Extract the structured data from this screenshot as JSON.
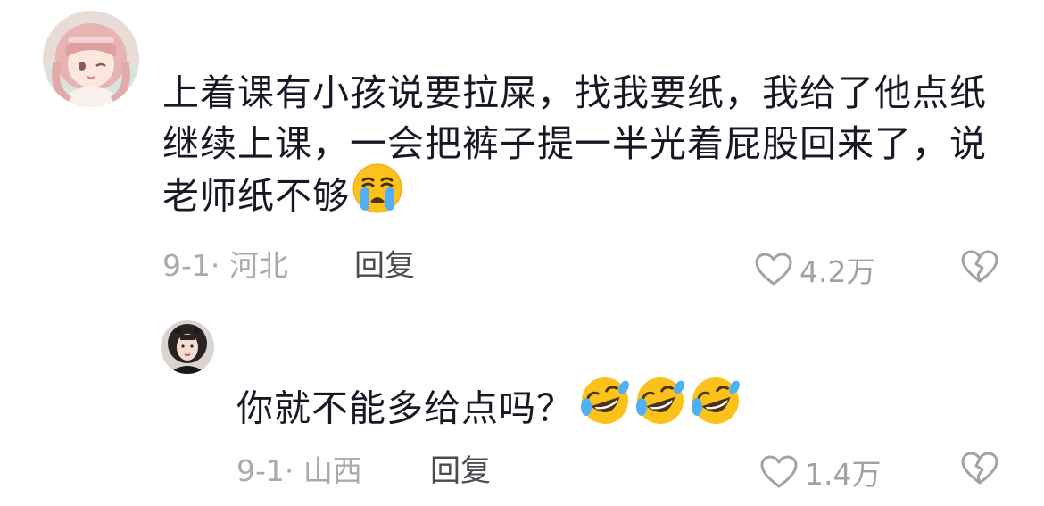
{
  "comments": [
    {
      "text": "上着课有小孩说要拉屎，找我要纸，我给了他点纸继续上课，一会把裤子提一半光着屁股回来了，说老师纸不够",
      "emojis": [
        "loudly-crying-face"
      ],
      "date_location": "9-1· 河北",
      "reply_label": "回复",
      "likes": "4.2万"
    },
    {
      "text": "你就不能多给点吗？",
      "emojis": [
        "rolling-on-floor-laughing",
        "rolling-on-floor-laughing",
        "rolling-on-floor-laughing"
      ],
      "date_location": "9-1· 山西",
      "reply_label": "回复",
      "likes": "1.4万"
    }
  ],
  "colors": {
    "text": "#161823",
    "meta": "#a9a9ae",
    "reply": "#4b4b52",
    "icon": "#a1a1a6",
    "emoji_yellow": "#fcc21b",
    "emoji_tear": "#4fb0f5"
  }
}
